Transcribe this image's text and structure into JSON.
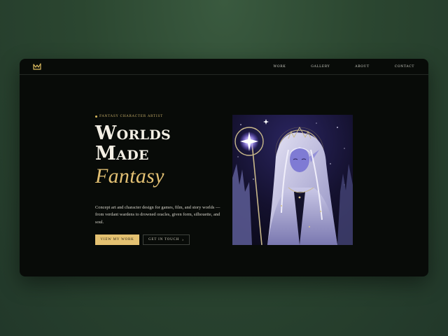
{
  "nav": {
    "links": [
      {
        "label": "Work"
      },
      {
        "label": "Gallery"
      },
      {
        "label": "About"
      },
      {
        "label": "Contact"
      }
    ]
  },
  "hero": {
    "eyebrow": "Fantasy Character Artist",
    "title_line1": "Worlds",
    "title_line2": "Made",
    "title_accent": "Fantasy",
    "description": "Concept art and character design for games, film, and story worlds — from verdant wardens to drowned oracles, given form, silhouette, and soul.",
    "primary_button": "View My Work",
    "secondary_button": "Get in Touch",
    "secondary_icon": "chevron-right-icon"
  },
  "colors": {
    "accent": "#e4c171",
    "background": "#080b08",
    "page_background": "#2b4630"
  }
}
